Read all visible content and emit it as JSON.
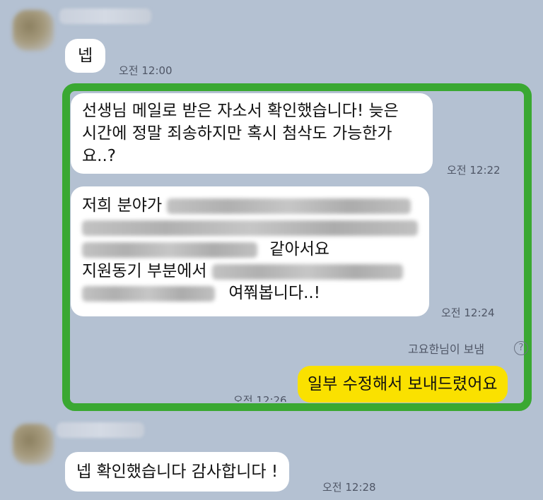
{
  "messages": {
    "m1": {
      "text": "넵",
      "time": "오전 12:00"
    },
    "m2": {
      "lines": [
        "선생님 메일로 받은 자소서 확인했습니다! 늦은",
        " 시간에 정말 죄송하지만 혹시 첨삭도 가능한가",
        "요..?"
      ],
      "time": "오전 12:22"
    },
    "m3": {
      "line1": "저희 분야가",
      "line3_end": "같아서요",
      "line4": "지원동기 부분에서",
      "line5_end": "여쭤봅니다..!",
      "time": "오전 12:24"
    },
    "m4": {
      "status": "고요한님이 보냄",
      "help_icon": "?",
      "text": "일부 수정해서 보내드렸어요",
      "time": "오전 12:26"
    },
    "m5": {
      "text": "넵 확인했습니다 감사합니다 !",
      "time": "오전 12:28"
    }
  },
  "colors": {
    "background": "#b4c1d2",
    "highlight_border": "#3aa832",
    "my_bubble": "#fae100",
    "other_bubble": "#ffffff"
  }
}
